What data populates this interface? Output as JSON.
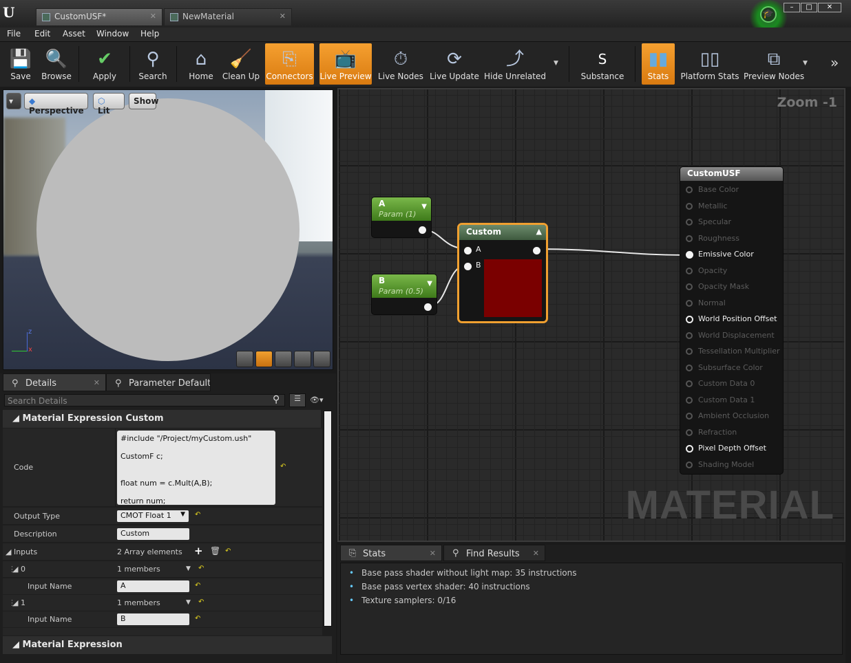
{
  "tabs": [
    {
      "label": "CustomUSF*"
    },
    {
      "label": "NewMaterial"
    }
  ],
  "menu": [
    "File",
    "Edit",
    "Asset",
    "Window",
    "Help"
  ],
  "toolbar": {
    "save": "Save",
    "browse": "Browse",
    "apply": "Apply",
    "search": "Search",
    "home": "Home",
    "cleanup": "Clean Up",
    "connectors": "Connectors",
    "livepreview": "Live Preview",
    "livenodes": "Live Nodes",
    "liveupdate": "Live Update",
    "hideunrelated": "Hide Unrelated",
    "substance": "Substance",
    "stats": "Stats",
    "platformstats": "Platform Stats",
    "previewnodes": "Preview Nodes"
  },
  "viewport": {
    "perspective": "Perspective",
    "lit": "Lit",
    "show": "Show"
  },
  "details": {
    "tab_details": "Details",
    "tab_params": "Parameter Defaults",
    "search_placeholder": "Search Details",
    "cat_custom": "Material Expression Custom",
    "code_label": "Code",
    "code": "#include \"/Project/myCustom.ush\"\n\nCustomF c;\n\n\nfloat num = c.Mult(A,B);\n\nreturn num;",
    "output_type_label": "Output Type",
    "output_type": "CMOT Float 1",
    "description_label": "Description",
    "description": "Custom",
    "inputs_label": "Inputs",
    "inputs_value": "2 Array elements",
    "input0_index": "0",
    "input0_members": "1 members",
    "input0_name_label": "Input Name",
    "input0_name": "A",
    "input1_index": "1",
    "input1_members": "1 members",
    "input1_name_label": "Input Name",
    "input1_name": "B",
    "cat_expression": "Material Expression"
  },
  "graph": {
    "zoom": "Zoom -1",
    "watermark": "MATERIAL",
    "paramA": {
      "title": "A",
      "sub": "Param (1)"
    },
    "paramB": {
      "title": "B",
      "sub": "Param (0.5)"
    },
    "custom": {
      "title": "Custom",
      "inA": "A",
      "inB": "B",
      "preview_color": "#7a0000"
    },
    "result": {
      "title": "CustomUSF",
      "inputs": [
        "Base Color",
        "Metallic",
        "Specular",
        "Roughness",
        "Emissive Color",
        "Opacity",
        "Opacity Mask",
        "Normal",
        "World Position Offset",
        "World Displacement",
        "Tessellation Multiplier",
        "Subsurface Color",
        "Custom Data 0",
        "Custom Data 1",
        "Ambient Occlusion",
        "Refraction",
        "Pixel Depth Offset",
        "Shading Model"
      ]
    }
  },
  "stats": {
    "tab_stats": "Stats",
    "tab_find": "Find Results",
    "lines": [
      "Base pass shader without light map: 35 instructions",
      "Base pass vertex shader: 40 instructions",
      "Texture samplers: 0/16"
    ]
  },
  "colors": {
    "accent": "#f0a030",
    "node_green": "#5a9a2a"
  }
}
